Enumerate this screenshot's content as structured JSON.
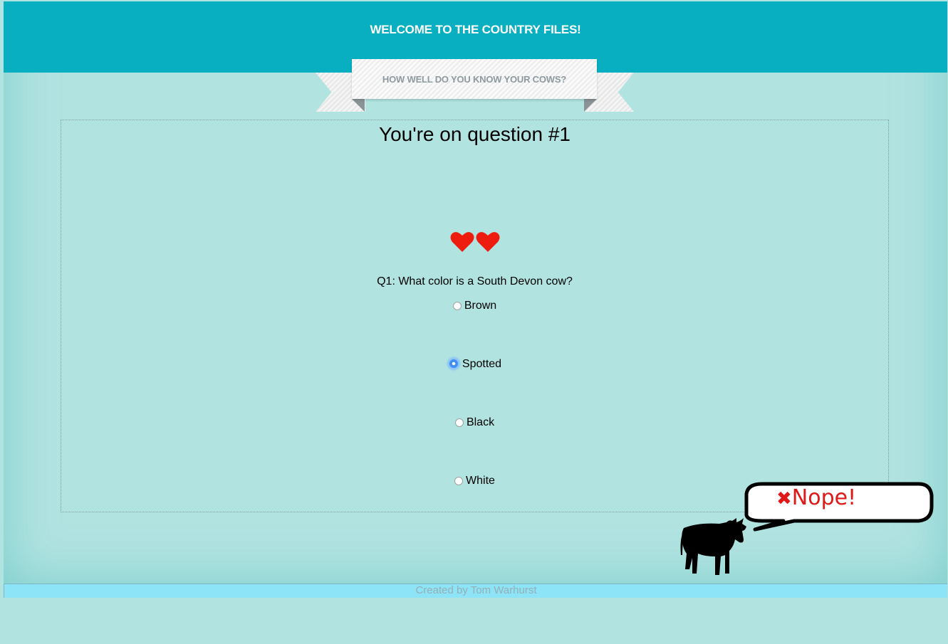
{
  "header": {
    "title": "WELCOME TO THE COUNTRY FILES!",
    "background": "#08afc1"
  },
  "ribbon": {
    "text": "HOW WELL DO YOU KNOW YOUR COWS?"
  },
  "quiz": {
    "question_number_label": "You're on question #1",
    "lives": 2,
    "heart_color": "#ee1c0e",
    "question": "Q1: What color is a South Devon cow?",
    "options": [
      {
        "label": "Brown",
        "selected": false
      },
      {
        "label": "Spotted",
        "selected": true
      },
      {
        "label": "Black",
        "selected": false
      },
      {
        "label": "White",
        "selected": false
      }
    ]
  },
  "feedback": {
    "icon": "cross-icon",
    "text": "Nope!",
    "color": "#e01818",
    "mascot": "cow-silhouette-icon"
  },
  "footer": {
    "credit": "Created by Tom Warhurst"
  }
}
